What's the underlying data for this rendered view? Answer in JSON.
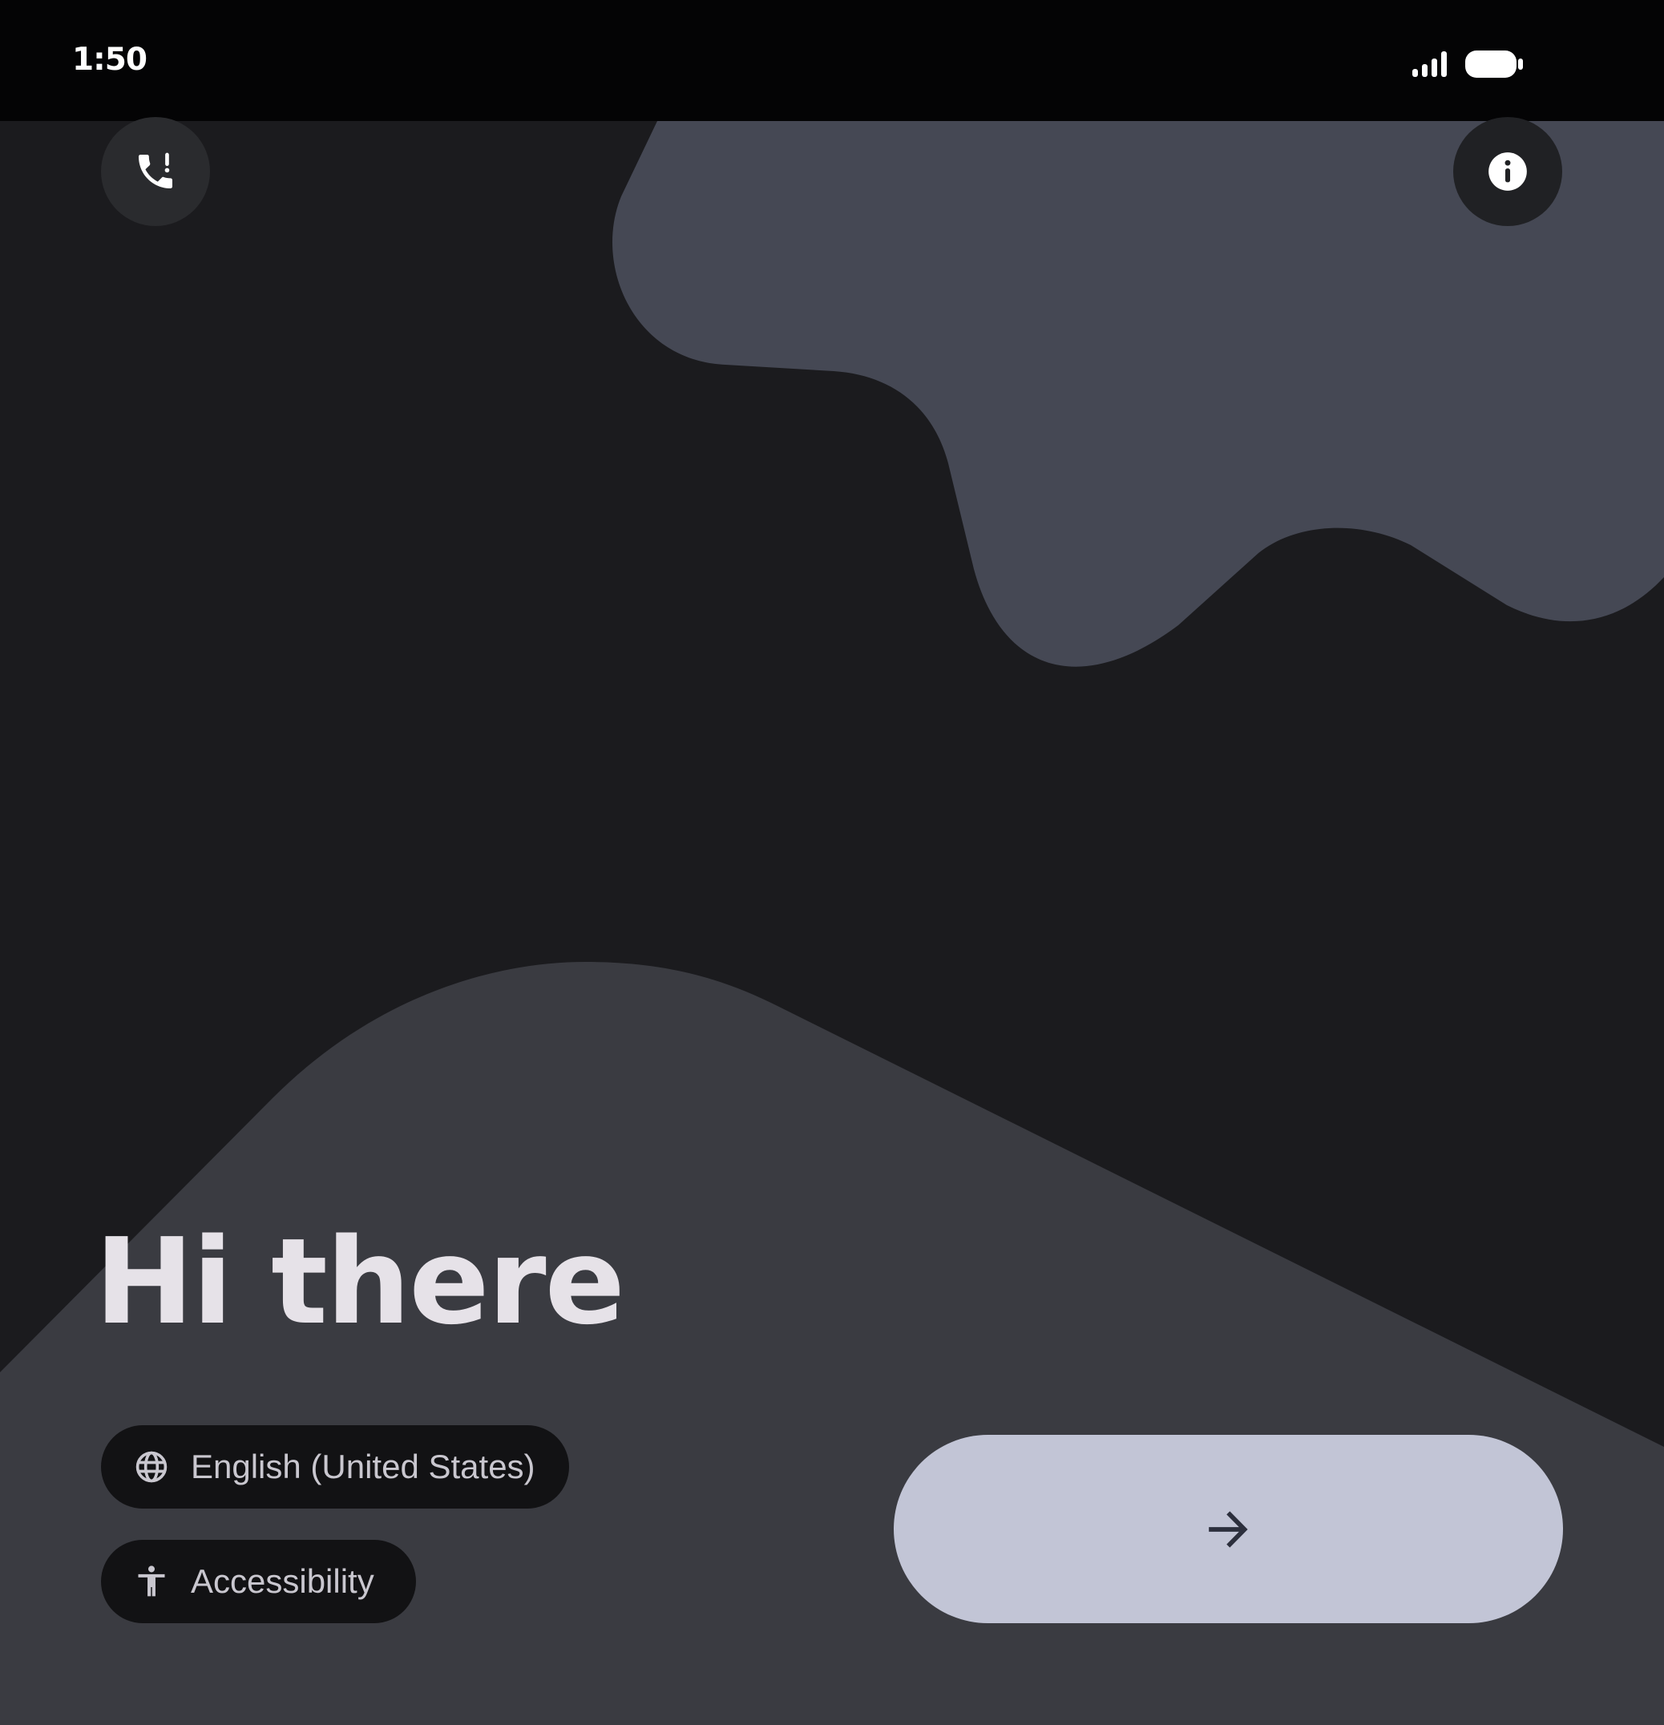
{
  "status_bar": {
    "time": "1:50",
    "signal_icon": "signal-strength-icon",
    "battery_icon": "battery-full-icon"
  },
  "top_actions": {
    "emergency_icon": "emergency-call-icon",
    "info_icon": "info-icon"
  },
  "greeting": "Hi there",
  "language_chip": {
    "icon": "globe-icon",
    "label": "English (United States)"
  },
  "accessibility_chip": {
    "icon": "accessibility-icon",
    "label": "Accessibility"
  },
  "next_button": {
    "icon": "arrow-forward-icon"
  },
  "colors": {
    "background": "#1b1b1e",
    "top_shape": "#454854",
    "bottom_shape": "#3a3b41",
    "chip_background": "#121214",
    "next_button": "#c2c5d6",
    "text_primary": "#e6e2e8"
  }
}
